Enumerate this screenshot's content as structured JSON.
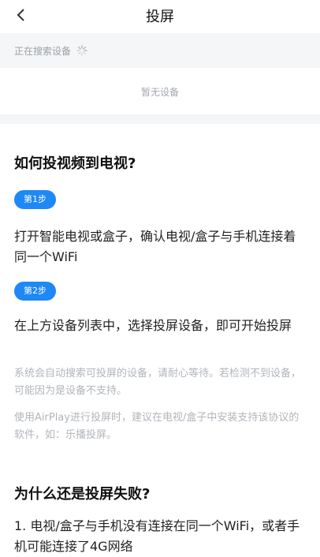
{
  "header": {
    "title": "投屏"
  },
  "search": {
    "status": "正在搜索设备",
    "empty": "暂无设备"
  },
  "howto": {
    "title": "如何投视频到电视?",
    "steps": [
      {
        "badge": "第1步",
        "text": "打开智能电视或盒子，确认电视/盒子与手机连接着同一个WiFi"
      },
      {
        "badge": "第2步",
        "text": "在上方设备列表中，选择投屏设备，即可开始投屏"
      }
    ],
    "notes": [
      "系统会自动搜索可投屏的设备，请耐心等待。若检测不到设备，可能因为是设备不支持。",
      "使用AirPlay进行投屏时，建议在电视/盒子中安装支持该协议的软件，如：乐播投屏。"
    ]
  },
  "faq": {
    "title": "为什么还是投屏失败?",
    "items": [
      "1. 电视/盒子与手机没有连接在同一个WiFi，或者手机可能连接了4G网络"
    ]
  },
  "colors": {
    "accent": "#1e88f5",
    "muted": "#b1b5bb"
  },
  "icons": {
    "back": "back-arrow-icon",
    "spinner": "loading-spinner-icon"
  }
}
